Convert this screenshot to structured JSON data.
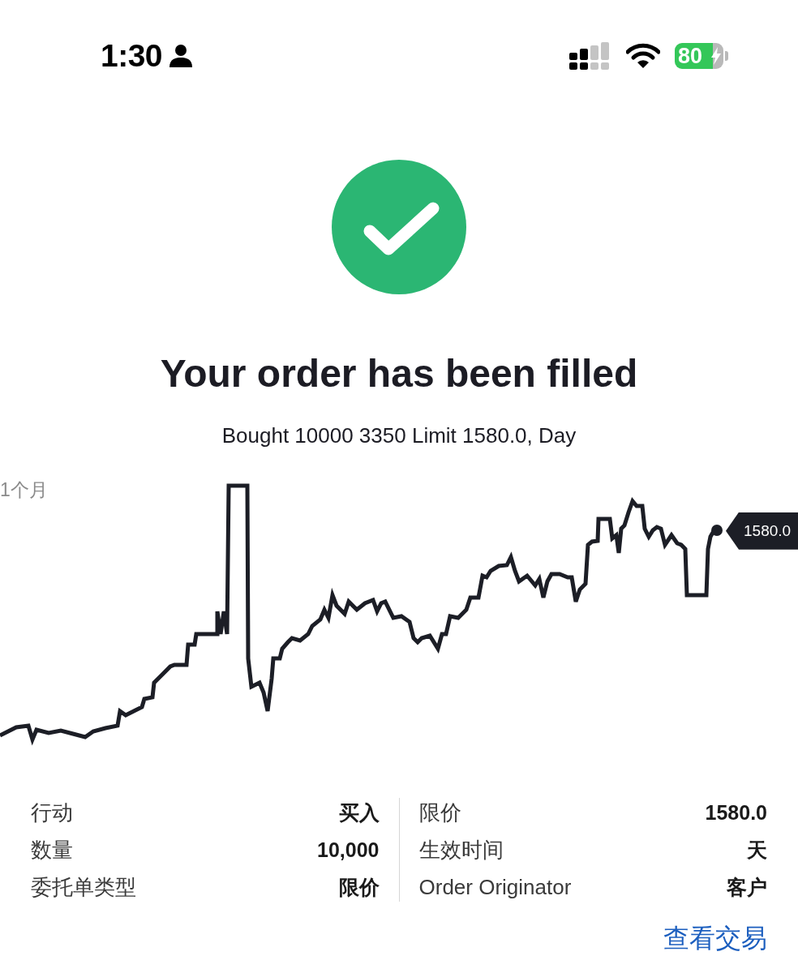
{
  "status_bar": {
    "time": "1:30",
    "battery": "80",
    "charging": true
  },
  "confirmation": {
    "title": "Your order has been filled",
    "subtitle": "Bought 10000 3350 Limit 1580.0, Day"
  },
  "chart": {
    "range_label": "1个月",
    "price_tag": "1580.0"
  },
  "details": {
    "left": [
      {
        "label": "行动",
        "value": "买入"
      },
      {
        "label": "数量",
        "value": "10,000"
      },
      {
        "label": "委托单类型",
        "value": "限价"
      }
    ],
    "right": [
      {
        "label": "限价",
        "value": "1580.0"
      },
      {
        "label": "生效时间",
        "value": "天"
      },
      {
        "label": "Order Originator",
        "value": "客户"
      }
    ]
  },
  "link": "查看交易"
}
